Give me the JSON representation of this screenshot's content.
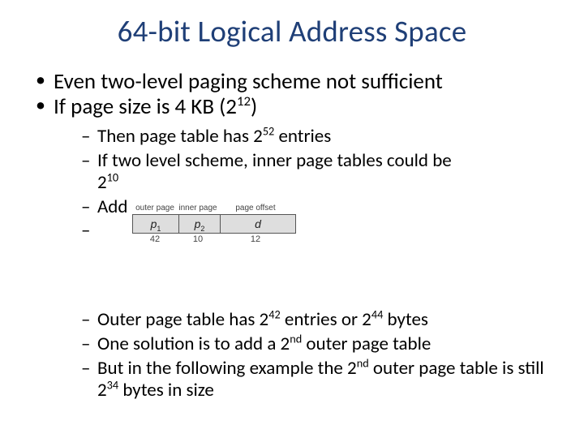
{
  "title": "64-bit Logical Address Space",
  "bullets": {
    "b1": "Even two-level paging scheme not sufficient",
    "b2_pre": "If page size is 4 KB (2",
    "b2_sup": "12",
    "b2_post": ")"
  },
  "sub": {
    "s1_pre": "Then page table has 2",
    "s1_sup": "52",
    "s1_post": " entries",
    "s2": "If two level scheme, inner page tables could be",
    "s2b_pre": " 2",
    "s2b_sup": "10",
    "s2c": "Add",
    "s3_pre": "Outer page table has 2",
    "s3_sup1": "42",
    "s3_mid": " entries or 2",
    "s3_sup2": "44",
    "s3_post": " bytes",
    "s4_pre": "One solution is to add a 2",
    "s4_sup": "nd",
    "s4_post": " outer page table",
    "s5_pre": "But in the following example the 2",
    "s5_sup": "nd",
    "s5_mid": " outer page table is still 2",
    "s5_sup2": "34",
    "s5_post": " bytes in size"
  },
  "figure": {
    "header": {
      "h1": "outer page",
      "h2": "inner page",
      "h3": "page offset"
    },
    "cells": {
      "c1": "p",
      "c1sub": "1",
      "c2": "p",
      "c2sub": "2",
      "c3": "d"
    },
    "widths": {
      "w1": "42",
      "w2": "10",
      "w3": "12"
    }
  }
}
